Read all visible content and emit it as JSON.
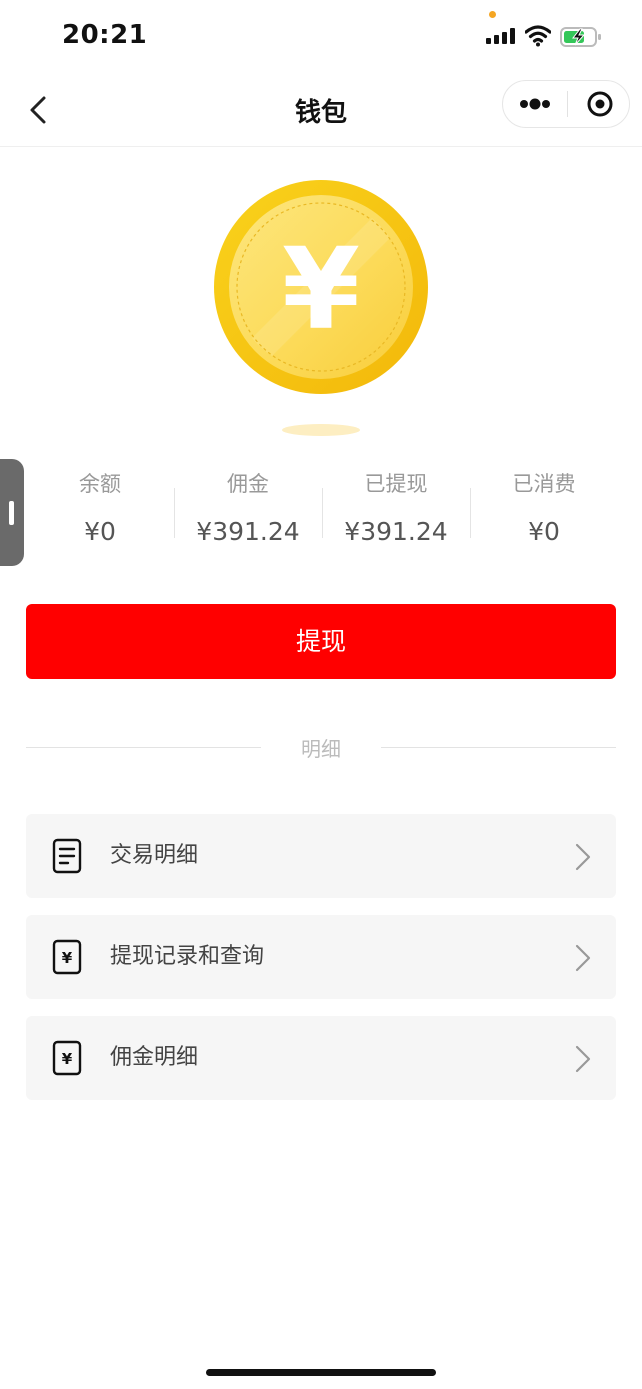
{
  "status_bar": {
    "time": "20:21",
    "icons": [
      "signal-icon",
      "wifi-icon",
      "battery-charging-icon"
    ],
    "indicator_color": "#f5a623"
  },
  "nav": {
    "title": "钱包",
    "icons": [
      "back-icon",
      "more-icon",
      "close-circle-icon"
    ]
  },
  "hero": {
    "icon": "yuan-coin-icon",
    "symbol": "¥",
    "coin_color": "#f7c515"
  },
  "stats": [
    {
      "label": "余额",
      "value": "¥0"
    },
    {
      "label": "佣金",
      "value": "¥391.24"
    },
    {
      "label": "已提现",
      "value": "¥391.24"
    },
    {
      "label": "已消费",
      "value": "¥0"
    }
  ],
  "withdraw": {
    "label": "提现",
    "color": "#ff0000"
  },
  "details": {
    "title": "明细",
    "items": [
      {
        "label": "交易明细",
        "icon": "document-icon"
      },
      {
        "label": "提现记录和查询",
        "icon": "yuan-receipt-icon"
      },
      {
        "label": "佣金明细",
        "icon": "yuan-receipt-icon"
      }
    ]
  }
}
